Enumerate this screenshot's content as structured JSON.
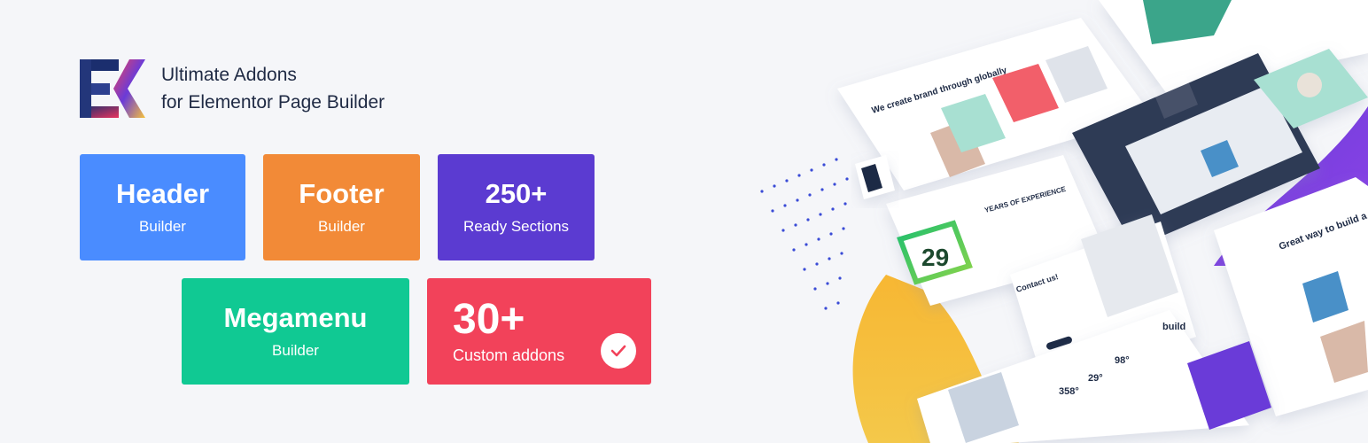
{
  "brand": {
    "line1": "Ultimate Addons",
    "line2": "for Elementor Page Builder",
    "logo_colors": [
      "#1b2e6e",
      "#f2425a",
      "#5b3bd1",
      "#f7c23a"
    ]
  },
  "tiles": [
    {
      "title": "Header",
      "subtitle": "Builder",
      "color": "#4a8cff"
    },
    {
      "title": "Footer",
      "subtitle": "Builder",
      "color": "#f28a37"
    },
    {
      "title": "250+",
      "subtitle": "Ready Sections",
      "color": "#5b3bd1"
    },
    {
      "title": "Megamenu",
      "subtitle": "Builder",
      "color": "#10c993"
    },
    {
      "title": "30+",
      "subtitle": "Custom addons",
      "color": "#f2425a",
      "icon": "check-icon"
    }
  ],
  "showcase": {
    "hero_text": "We create brand through globally",
    "years_number": "29",
    "years_text": "YEARS OF EXPERIENCE",
    "contact_title": "Contact us!",
    "build_title": "Great way to build a brand",
    "build_word": "build",
    "stats": [
      "358°",
      "29°",
      "98°"
    ]
  }
}
